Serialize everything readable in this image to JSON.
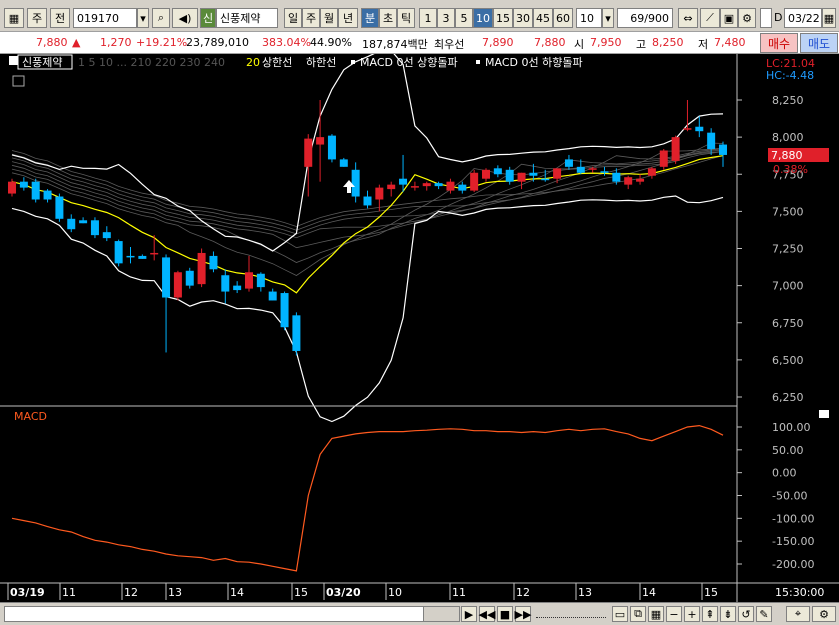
{
  "toolbar": {
    "period_label": "주",
    "prev_label": "전",
    "code": "019170",
    "stock_badge": "신",
    "stock_name": "신풍제약",
    "tab_day": "일",
    "tab_week": "주",
    "tab_month": "월",
    "tab_year": "년",
    "tab_min": "분",
    "tab_sec": "초",
    "tab_tick": "틱",
    "intervals": [
      "1",
      "3",
      "5",
      "10",
      "15",
      "30",
      "45",
      "60"
    ],
    "interval_value": "10",
    "count": "69",
    "count_total": "/900",
    "date_label": "D",
    "date_value": "03/22"
  },
  "quote": {
    "price": "7,880",
    "arrow": "▲",
    "change": "1,270",
    "pct": "+19.21%",
    "volume": "23,789,010",
    "vol_ratio": "383.04%",
    "turnover": "44.90%",
    "amount": "187,874백만",
    "best_ask_label": "최우선",
    "best_ask": "7,890",
    "best_bid": "7,880",
    "open_label": "시",
    "open": "7,950",
    "high_label": "고",
    "high": "8,250",
    "low_label": "저",
    "low": "7,480",
    "buy_label": "매수",
    "sell_label": "매도"
  },
  "legend": {
    "name": "신풍제약",
    "dim": "1 5 10 ... 210 220 230 240",
    "ma20": "20",
    "upper": "상한선",
    "lower": "하한선",
    "macd_up": "MACD 0선 상향돌파",
    "macd_down": "MACD 0선 하향돌파"
  },
  "price_labels": {
    "lc": "LC:21.04",
    "hc": "HC:-4.48",
    "current": "7,880",
    "current_pct": "0.38%"
  },
  "price_axis": [
    "8,250",
    "8,000",
    "7,750",
    "7,500",
    "7,250",
    "7,000",
    "6,750",
    "6,500",
    "6,250"
  ],
  "macd_title": "MACD",
  "macd_axis": [
    "100.00",
    "50.00",
    "0.00",
    "-50.00",
    "-100.00",
    "-150.00",
    "-200.00"
  ],
  "time_axis": [
    {
      "label": "03/19",
      "bold": true
    },
    {
      "label": "11"
    },
    {
      "label": "12"
    },
    {
      "label": "13"
    },
    {
      "label": "14"
    },
    {
      "label": "15"
    },
    {
      "label": "03/20",
      "bold": true
    },
    {
      "label": "10"
    },
    {
      "label": "11"
    },
    {
      "label": "12"
    },
    {
      "label": "13"
    },
    {
      "label": "14"
    },
    {
      "label": "15"
    }
  ],
  "clock": "15:30:00",
  "colors": {
    "up": "#e0202a",
    "down": "#00b4ff",
    "ma20": "#ffff00",
    "band": "#ffffff",
    "macd": "#ff5a1f",
    "axis": "#c0c0c0"
  },
  "chart_data": {
    "type": "candlestick",
    "price_range": [
      6250,
      8250
    ],
    "candles": [
      {
        "o": 7620,
        "h": 7720,
        "l": 7600,
        "c": 7700
      },
      {
        "o": 7700,
        "h": 7730,
        "l": 7640,
        "c": 7660
      },
      {
        "o": 7700,
        "h": 7720,
        "l": 7560,
        "c": 7580
      },
      {
        "o": 7640,
        "h": 7650,
        "l": 7560,
        "c": 7580
      },
      {
        "o": 7600,
        "h": 7620,
        "l": 7430,
        "c": 7450
      },
      {
        "o": 7450,
        "h": 7480,
        "l": 7360,
        "c": 7380
      },
      {
        "o": 7440,
        "h": 7460,
        "l": 7420,
        "c": 7420
      },
      {
        "o": 7440,
        "h": 7460,
        "l": 7320,
        "c": 7340
      },
      {
        "o": 7360,
        "h": 7400,
        "l": 7300,
        "c": 7320
      },
      {
        "o": 7300,
        "h": 7310,
        "l": 7130,
        "c": 7150
      },
      {
        "o": 7200,
        "h": 7260,
        "l": 7150,
        "c": 7190
      },
      {
        "o": 7200,
        "h": 7210,
        "l": 7180,
        "c": 7180
      },
      {
        "o": 7210,
        "h": 7340,
        "l": 7170,
        "c": 7220
      },
      {
        "o": 7190,
        "h": 7210,
        "l": 6550,
        "c": 6920
      },
      {
        "o": 6920,
        "h": 7100,
        "l": 6900,
        "c": 7090
      },
      {
        "o": 7100,
        "h": 7120,
        "l": 6980,
        "c": 7000
      },
      {
        "o": 7010,
        "h": 7250,
        "l": 6990,
        "c": 7220
      },
      {
        "o": 7200,
        "h": 7230,
        "l": 7090,
        "c": 7110
      },
      {
        "o": 7070,
        "h": 7110,
        "l": 6880,
        "c": 6960
      },
      {
        "o": 7000,
        "h": 7030,
        "l": 6950,
        "c": 6970
      },
      {
        "o": 6980,
        "h": 7200,
        "l": 6960,
        "c": 7090
      },
      {
        "o": 7080,
        "h": 7090,
        "l": 6960,
        "c": 6990
      },
      {
        "o": 6960,
        "h": 6980,
        "l": 6900,
        "c": 6900
      },
      {
        "o": 6950,
        "h": 6960,
        "l": 6700,
        "c": 6720
      },
      {
        "o": 6800,
        "h": 6820,
        "l": 6530,
        "c": 6560
      },
      {
        "o": 7800,
        "h": 8020,
        "l": 7600,
        "c": 7990
      },
      {
        "o": 7950,
        "h": 8250,
        "l": 7700,
        "c": 8000
      },
      {
        "o": 8010,
        "h": 8020,
        "l": 7830,
        "c": 7850
      },
      {
        "o": 7850,
        "h": 7860,
        "l": 7800,
        "c": 7800
      },
      {
        "o": 7780,
        "h": 7830,
        "l": 7560,
        "c": 7600
      },
      {
        "o": 7600,
        "h": 7640,
        "l": 7520,
        "c": 7540
      },
      {
        "o": 7580,
        "h": 7680,
        "l": 7500,
        "c": 7660
      },
      {
        "o": 7650,
        "h": 7700,
        "l": 7600,
        "c": 7680
      },
      {
        "o": 7720,
        "h": 7880,
        "l": 7630,
        "c": 7680
      },
      {
        "o": 7660,
        "h": 7700,
        "l": 7640,
        "c": 7670
      },
      {
        "o": 7670,
        "h": 7700,
        "l": 7640,
        "c": 7690
      },
      {
        "o": 7690,
        "h": 7700,
        "l": 7650,
        "c": 7670
      },
      {
        "o": 7640,
        "h": 7720,
        "l": 7620,
        "c": 7700
      },
      {
        "o": 7680,
        "h": 7700,
        "l": 7620,
        "c": 7640
      },
      {
        "o": 7640,
        "h": 7780,
        "l": 7630,
        "c": 7760
      },
      {
        "o": 7720,
        "h": 7790,
        "l": 7700,
        "c": 7780
      },
      {
        "o": 7790,
        "h": 7810,
        "l": 7730,
        "c": 7750
      },
      {
        "o": 7780,
        "h": 7800,
        "l": 7680,
        "c": 7700
      },
      {
        "o": 7700,
        "h": 7760,
        "l": 7650,
        "c": 7760
      },
      {
        "o": 7760,
        "h": 7820,
        "l": 7700,
        "c": 7740
      },
      {
        "o": 7720,
        "h": 7780,
        "l": 7700,
        "c": 7710
      },
      {
        "o": 7720,
        "h": 7790,
        "l": 7690,
        "c": 7790
      },
      {
        "o": 7850,
        "h": 7880,
        "l": 7780,
        "c": 7800
      },
      {
        "o": 7800,
        "h": 7850,
        "l": 7750,
        "c": 7760
      },
      {
        "o": 7780,
        "h": 7800,
        "l": 7760,
        "c": 7790
      },
      {
        "o": 7770,
        "h": 7800,
        "l": 7740,
        "c": 7760
      },
      {
        "o": 7760,
        "h": 7790,
        "l": 7680,
        "c": 7700
      },
      {
        "o": 7680,
        "h": 7740,
        "l": 7650,
        "c": 7730
      },
      {
        "o": 7700,
        "h": 7750,
        "l": 7680,
        "c": 7720
      },
      {
        "o": 7740,
        "h": 7800,
        "l": 7720,
        "c": 7790
      },
      {
        "o": 7800,
        "h": 7920,
        "l": 7780,
        "c": 7910
      },
      {
        "o": 7840,
        "h": 8010,
        "l": 7820,
        "c": 8000
      },
      {
        "o": 8050,
        "h": 8250,
        "l": 8040,
        "c": 8060
      },
      {
        "o": 8070,
        "h": 8140,
        "l": 8000,
        "c": 8040
      },
      {
        "o": 8030,
        "h": 8060,
        "l": 7880,
        "c": 7920
      },
      {
        "o": 7950,
        "h": 7970,
        "l": 7800,
        "c": 7880
      }
    ],
    "macd": [
      -100,
      -105,
      -110,
      -118,
      -125,
      -130,
      -140,
      -148,
      -152,
      -158,
      -162,
      -168,
      -172,
      -178,
      -182,
      -184,
      -186,
      -192,
      -188,
      -195,
      -196,
      -200,
      -205,
      -210,
      -215,
      -50,
      40,
      75,
      80,
      85,
      88,
      90,
      90,
      90,
      92,
      93,
      95,
      96,
      95,
      92,
      92,
      90,
      90,
      88,
      90,
      88,
      92,
      95,
      92,
      95,
      96,
      90,
      85,
      75,
      70,
      80,
      90,
      100,
      103,
      95,
      82
    ]
  }
}
